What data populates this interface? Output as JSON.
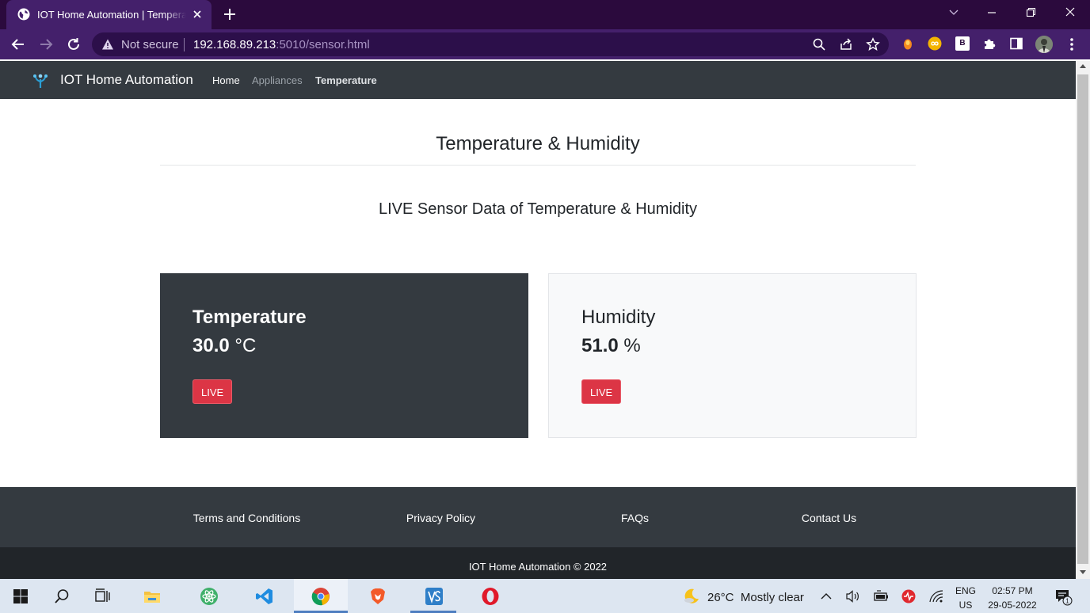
{
  "browser": {
    "tab_title": "IOT Home Automation | Temperature",
    "not_secure": "Not secure",
    "url_host": "192.168.89.213",
    "url_rest": ":5010/sensor.html",
    "extensions": [
      "honey-extension",
      "infinity-extension",
      "b-extension",
      "puzzle-extensions"
    ],
    "ext_b_label": "B"
  },
  "navbar": {
    "brand": "IOT Home Automation",
    "links": [
      "Home",
      "Appliances",
      "Temperature"
    ],
    "active_link": "Temperature"
  },
  "main": {
    "title": "Temperature & Humidity",
    "subtitle": "LIVE Sensor Data of Temperature & Humidity",
    "cards": [
      {
        "label": "Temperature",
        "value": "30.0",
        "unit": "°C",
        "button": "LIVE",
        "theme": "dark"
      },
      {
        "label": "Humidity",
        "value": "51.0",
        "unit": "%",
        "button": "LIVE",
        "theme": "light"
      }
    ]
  },
  "footer": {
    "links": [
      "Terms and Conditions",
      "Privacy Policy",
      "FAQs",
      "Contact Us"
    ],
    "copyright": "IOT Home Automation © 2022"
  },
  "taskbar": {
    "weather_temp": "26°C",
    "weather_desc": "Mostly clear",
    "lang_top": "ENG",
    "lang_bottom": "US",
    "time": "02:57 PM",
    "date": "29-05-2022",
    "notification_count": "1"
  },
  "colors": {
    "browser_frame": "#2b0a3d",
    "browser_toolbar": "#44206b",
    "navbar": "#343a40",
    "live_button": "#dc3545",
    "footer_bottom": "#212529"
  }
}
